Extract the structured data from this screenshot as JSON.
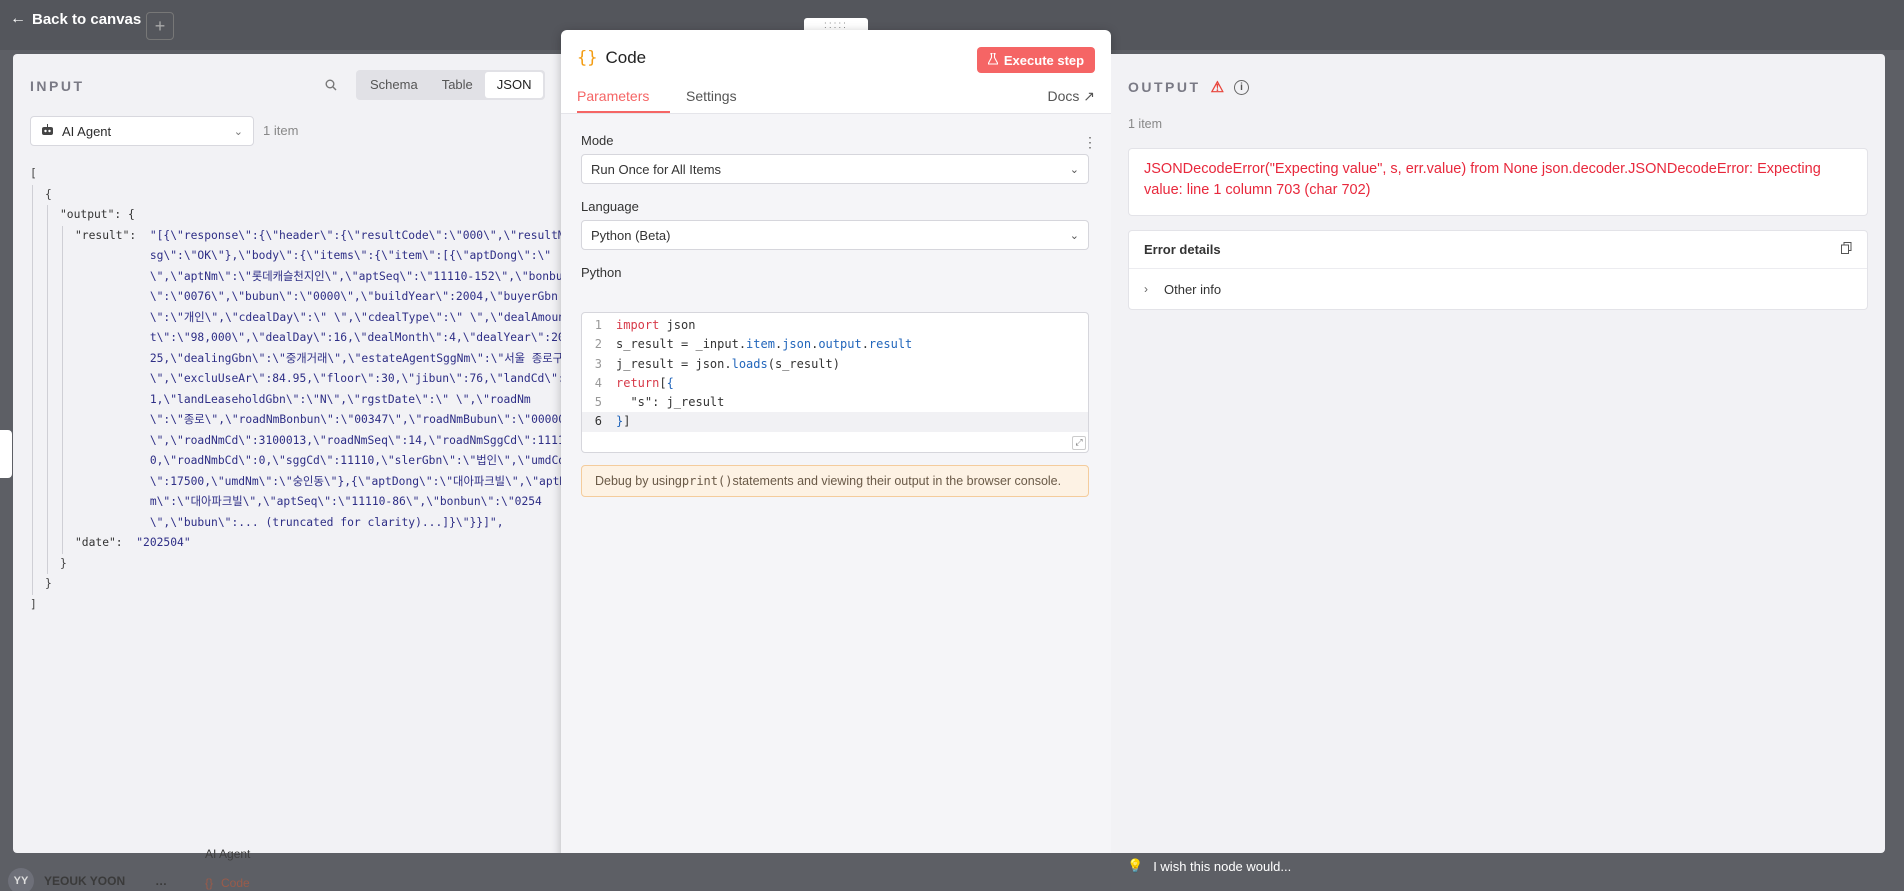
{
  "topbar": {
    "back_label": "Back to canvas",
    "back_icon": "arrow-left-icon",
    "plus_label": "+"
  },
  "input": {
    "title": "INPUT",
    "view_tabs": [
      "Schema",
      "Table",
      "JSON"
    ],
    "active_tab": "JSON",
    "node_select": "AI Agent",
    "items_count": "1 item",
    "json": {
      "open_bracket": "[",
      "open_brace": "{",
      "output_key": "\"output\": {",
      "result_key": "\"result\":  ",
      "result_value": "\"[{\\\"response\\\":{\\\"header\\\":{\\\"resultCode\\\":\\\"000\\\",\\\"resultMsg\\\":\\\"OK\\\"},\\\"body\\\":{\\\"items\\\":{\\\"item\\\":[{\\\"aptDong\\\":\\\" \\\",\\\"aptNm\\\":\\\"롯데캐슬천지인\\\",\\\"aptSeq\\\":\\\"11110-152\\\",\\\"bonbun\\\":\\\"0076\\\",\\\"bubun\\\":\\\"0000\\\",\\\"buildYear\\\":2004,\\\"buyerGbn\\\":\\\"개인\\\",\\\"cdealDay\\\":\\\" \\\",\\\"cdealType\\\":\\\" \\\",\\\"dealAmount\\\":\\\"98,000\\\",\\\"dealDay\\\":16,\\\"dealMonth\\\":4,\\\"dealYear\\\":2025,\\\"dealingGbn\\\":\\\"중개거래\\\",\\\"estateAgentSggNm\\\":\\\"서울 종로구\\\",\\\"excluUseAr\\\":84.95,\\\"floor\\\":30,\\\"jibun\\\":76,\\\"landCd\\\":1,\\\"landLeaseholdGbn\\\":\\\"N\\\",\\\"rgstDate\\\":\\\" \\\",\\\"roadNm\\\":\\\"종로\\\",\\\"roadNmBonbun\\\":\\\"00347\\\",\\\"roadNmBubun\\\":\\\"00000\\\",\\\"roadNmCd\\\":3100013,\\\"roadNmSeq\\\":14,\\\"roadNmSggCd\\\":11110,\\\"roadNmbCd\\\":0,\\\"sggCd\\\":11110,\\\"slerGbn\\\":\\\"법인\\\",\\\"umdCd\\\":17500,\\\"umdNm\\\":\\\"숭인동\\\"},{\\\"aptDong\\\":\\\"대아파크빌\\\",\\\"aptNm\\\":\\\"대아파크빌\\\",\\\"aptSeq\\\":\\\"11110-86\\\",\\\"bonbun\\\":\\\"0254\\\",\\\"bubun\\\":... (truncated for clarity)...]}\\\"}}]\",",
      "date_key": "\"date\":  ",
      "date_value": "\"202504\"",
      "close_brace_inner": "}",
      "close_brace": "}",
      "close_bracket": "]"
    }
  },
  "code_panel": {
    "drag_handle": ":::::",
    "title": "Code",
    "title_icon": "{}",
    "execute_label": "Execute step",
    "tabs": [
      "Parameters",
      "Settings"
    ],
    "active_tab": "Parameters",
    "docs_label": "Docs",
    "mode_label": "Mode",
    "mode_value": "Run Once for All Items",
    "language_label": "Language",
    "language_value": "Python (Beta)",
    "python_label": "Python",
    "code_lines": [
      {
        "n": "1",
        "parts": [
          [
            "kw",
            "import"
          ],
          [
            "",
            " json"
          ]
        ]
      },
      {
        "n": "2",
        "parts": [
          [
            "",
            "s_result = _input."
          ],
          [
            "fn",
            "item"
          ],
          [
            "",
            "."
          ],
          [
            "fn",
            "json"
          ],
          [
            "",
            "."
          ],
          [
            "fn",
            "output"
          ],
          [
            "",
            "."
          ],
          [
            "fn",
            "result"
          ]
        ]
      },
      {
        "n": "3",
        "parts": [
          [
            "",
            "j_result = json."
          ],
          [
            "fn",
            "loads"
          ],
          [
            "",
            "(s_result)"
          ]
        ]
      },
      {
        "n": "4",
        "parts": [
          [
            "kw",
            "return"
          ],
          [
            "",
            "["
          ],
          [
            "fn",
            "{"
          ]
        ]
      },
      {
        "n": "5",
        "parts": [
          [
            "",
            "  \"s\": j_result"
          ]
        ]
      },
      {
        "n": "6",
        "parts": [
          [
            "fn",
            "}"
          ],
          [
            "",
            "]"
          ]
        ]
      }
    ],
    "hint_prefix": "Debug by using ",
    "hint_code": "print()",
    "hint_suffix": " statements and viewing their output in the browser console."
  },
  "output": {
    "title": "OUTPUT",
    "items_count": "1 item",
    "error_message": "JSONDecodeError(\"Expecting value\", s, err.value) from None json.decoder.JSONDecodeError: Expecting value: line 1 column 703 (char 702)",
    "details_title": "Error details",
    "other_info": "Other info"
  },
  "background": {
    "user_initials": "YY",
    "user_name": "YEOUK YOON",
    "user_menu": "…",
    "ai_agent": "AI Agent",
    "code_label": "Code",
    "wish_label": "I wish this node would..."
  },
  "colors": {
    "accent": "#f56565",
    "error": "#e8283c",
    "warning_bg": "#fdf2e4"
  }
}
